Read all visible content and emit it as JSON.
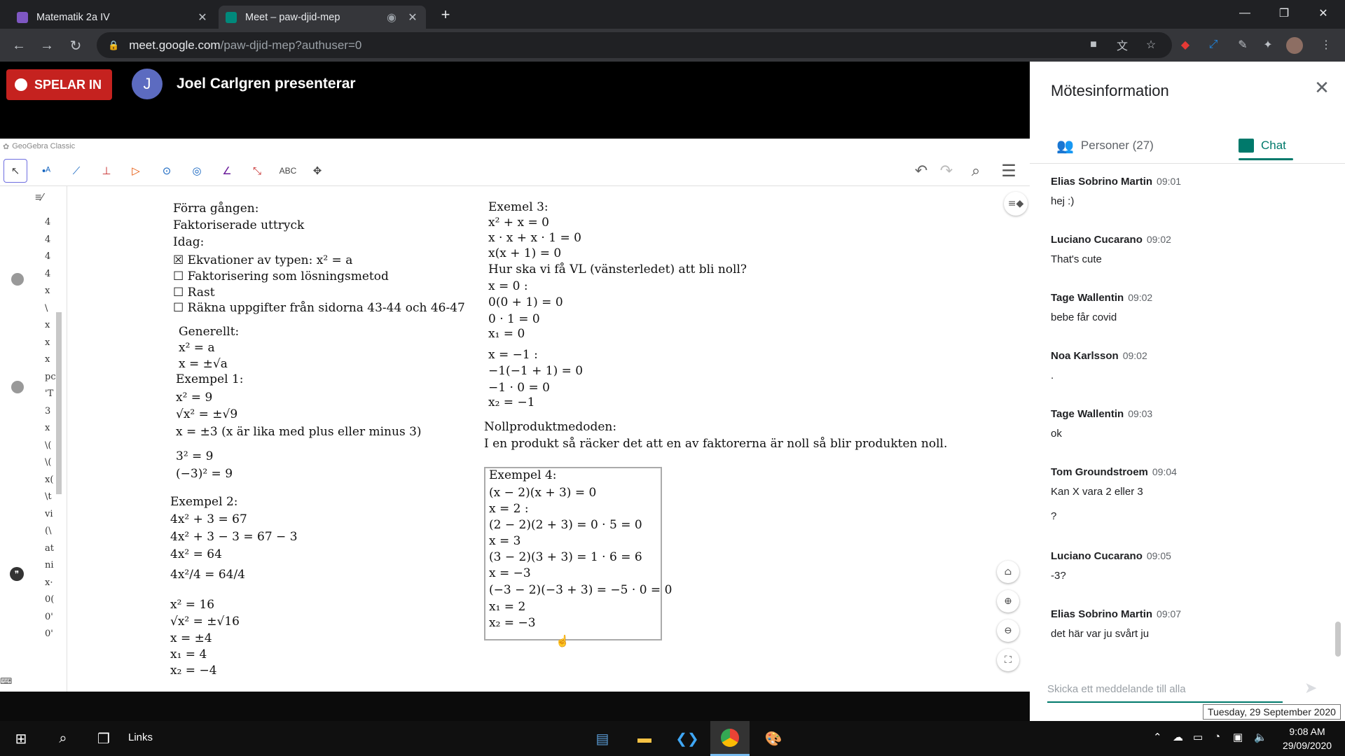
{
  "browser": {
    "tabs": [
      {
        "title": "Matematik 2a IV",
        "favicon_color": "#7e57c2"
      },
      {
        "title": "Meet – paw-djid-mep",
        "favicon_color": "#00897b"
      }
    ],
    "url_host": "meet.google.com",
    "url_path": "/paw-djid-mep?authuser=0"
  },
  "meet": {
    "recording_label": "SPELAR IN",
    "presenter_initial": "J",
    "presenter_label": "Joel Carlgren presenterar"
  },
  "geogebra": {
    "window_title": "GeoGebra Classic",
    "abc_tool": "ABC",
    "left_col": {
      "lines": [
        "Förra gången:",
        "Faktoriserade uttryck",
        "Idag:",
        "☒ Ekvationer av typen: x² = a",
        "☐ Faktorisering som lösningsmetod",
        "☐ Rast",
        "☐ Räkna uppgifter från sidorna 43-44 och 46-47",
        "Generellt:",
        "x² = a",
        "x = ±√a",
        "Exempel 1:",
        "x² = 9",
        "√x² = ±√9",
        "x = ±3 (x är lika med plus eller minus 3)",
        "3² = 9",
        "(−3)² = 9",
        "Exempel 2:",
        "4x² + 3 = 67",
        "4x² + 3 − 3 = 67 − 3",
        "4x² = 64",
        "4x²/4 = 64/4",
        "x² = 16",
        "√x² = ±√16",
        "x = ±4",
        "x₁ = 4",
        "x₂ = −4"
      ]
    },
    "right_col": {
      "lines": [
        "Exemel 3:",
        "x² + x = 0",
        "x · x + x · 1 = 0",
        "x(x + 1) = 0",
        "Hur ska vi få VL (vänsterledet) att bli noll?",
        "x = 0 :",
        "0(0 + 1) = 0",
        "0 · 1 = 0",
        "x₁ = 0",
        "x = −1 :",
        "−1(−1 + 1) = 0",
        "−1 · 0 = 0",
        "x₂ = −1",
        "Nollproduktmedoden:",
        "I en produkt så räcker det att en av faktorerna är noll så blir produkten noll."
      ]
    },
    "example4": {
      "lines": [
        "Exempel 4:",
        "(x − 2)(x + 3) = 0",
        "x = 2 :",
        "(2 − 2)(2 + 3) = 0 · 5 = 0",
        "x = 3",
        "(3 − 2)(3 + 3) = 1 · 6 = 6",
        "x = −3",
        "(−3 − 2)(−3 + 3) = −5 · 0 = 0",
        "x₁ = 2",
        "x₂ = −3"
      ]
    },
    "algebra_fragments": [
      "4",
      "4",
      "4",
      "4",
      "x",
      "\\",
      "x",
      "x",
      "x",
      "pc",
      "'T",
      "3",
      "x",
      "\\(",
      "\\(",
      "x(",
      "\\t",
      "vi",
      "(\\",
      "at",
      "ni",
      "x·",
      "0(",
      "0'",
      "0'"
    ]
  },
  "panel": {
    "title": "Mötesinformation",
    "tab_people": "Personer (27)",
    "tab_chat": "Chat",
    "messages": [
      {
        "sender": "Elias Sobrino Martin",
        "time": "09:01",
        "text": "hej :)"
      },
      {
        "sender": "Luciano Cucarano",
        "time": "09:02",
        "text": "That's cute"
      },
      {
        "sender": "Tage Wallentin",
        "time": "09:02",
        "text": "bebe får covid"
      },
      {
        "sender": "Noa Karlsson",
        "time": "09:02",
        "text": "."
      },
      {
        "sender": "Tage Wallentin",
        "time": "09:03",
        "text": "ok"
      },
      {
        "sender": "Tom Groundstroem",
        "time": "09:04",
        "text": "Kan X vara 2 eller 3",
        "text2": "?"
      },
      {
        "sender": "Luciano Cucarano",
        "time": "09:05",
        "text": "-3?"
      },
      {
        "sender": "Elias Sobrino Martin",
        "time": "09:07",
        "text": "det här var ju svårt ju"
      }
    ],
    "input_placeholder": "Skicka ett meddelande till alla"
  },
  "taskbar": {
    "links_label": "Links",
    "time": "9:08 AM",
    "date": "29/09/2020",
    "date_tooltip": "Tuesday, 29 September 2020"
  },
  "colors": {
    "record": "#c5221f",
    "accent_teal": "#00796b",
    "avatar": "#5c6bc0"
  }
}
